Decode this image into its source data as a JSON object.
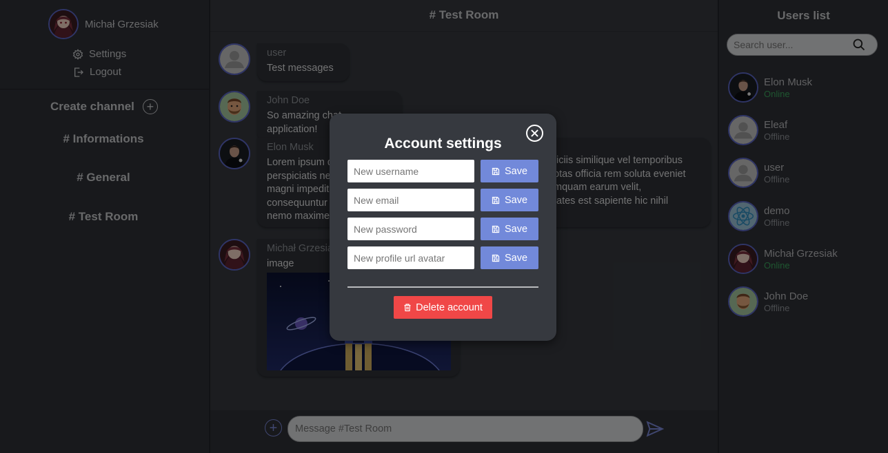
{
  "current_user": {
    "name": "Michał Grzesiak",
    "avatar_icon": "anime-avatar-icon"
  },
  "menu": {
    "settings": "Settings",
    "logout": "Logout"
  },
  "channels": {
    "create_label": "Create channel",
    "items": [
      "# Informations",
      "# General",
      "# Test Room"
    ]
  },
  "chat": {
    "room_title": "# Test Room",
    "messages": [
      {
        "author": "user",
        "lines": [
          "Test messages"
        ]
      },
      {
        "author": "John Doe",
        "lines": [
          "So amazing chat application!"
        ]
      },
      {
        "author": "Elon Musk",
        "lines": [
          "Lorem ipsum d",
          "perspiciatis ne",
          "magni impedit",
          "consequuntur",
          "nemo maxime"
        ],
        "right_lines": [
          "ficiis similique vel temporibus",
          "ptas officia rem soluta eveniet",
          "mquam earum velit,",
          "tates est sapiente hic nihil"
        ]
      },
      {
        "author": "Michał Grzesia",
        "lines": [
          "image"
        ],
        "image": "rocket-space-image"
      }
    ],
    "composer_placeholder": "Message #Test Room"
  },
  "users_panel": {
    "title": "Users list",
    "search_placeholder": "Search user...",
    "users": [
      {
        "name": "Elon Musk",
        "status": "Online"
      },
      {
        "name": "Eleaf",
        "status": "Offline"
      },
      {
        "name": "user",
        "status": "Offline"
      },
      {
        "name": "demo",
        "status": "Offline"
      },
      {
        "name": "Michał Grzesiak",
        "status": "Online"
      },
      {
        "name": "John Doe",
        "status": "Offline"
      }
    ]
  },
  "modal": {
    "title": "Account settings",
    "fields": [
      {
        "placeholder": "New username",
        "button": "Save"
      },
      {
        "placeholder": "New email",
        "button": "Save"
      },
      {
        "placeholder": "New password",
        "button": "Save"
      },
      {
        "placeholder": "New profile url avatar",
        "button": "Save"
      }
    ],
    "delete_label": "Delete account"
  },
  "colors": {
    "accent": "#7289da",
    "online": "#3ba55d",
    "offline": "#8e9297",
    "danger": "#f04747"
  }
}
